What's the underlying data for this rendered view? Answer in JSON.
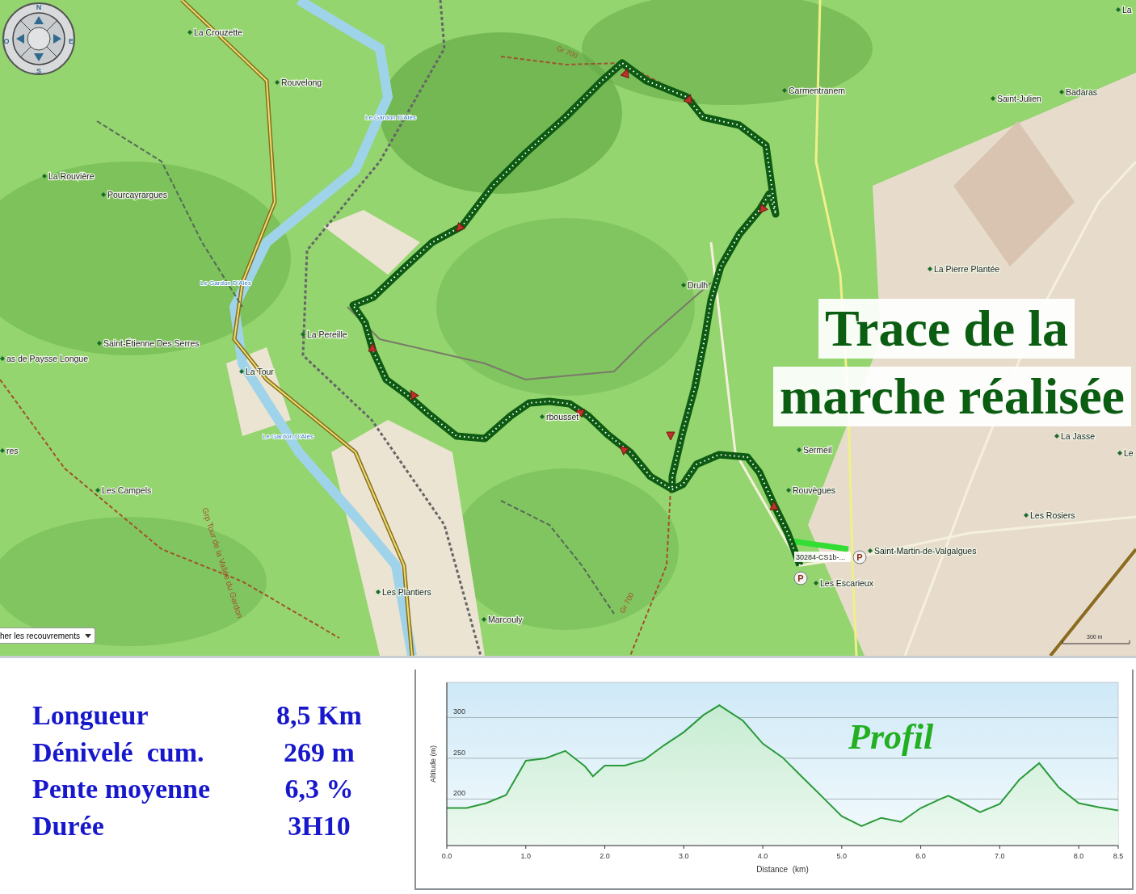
{
  "compass": {
    "labels": [
      "N",
      "E",
      "S",
      "O"
    ]
  },
  "map": {
    "places": [
      "La Crouzette",
      "Rouvelong",
      "Carmentranem",
      "Saint-Julien",
      "Badaras",
      "La",
      "La Rouvière",
      "Pourcayrargues",
      "La Pierre Plantée",
      "Drulh",
      "La Pereille",
      "Saint-Étienne Des Serres",
      "as de Paysse Longue",
      "La Tour",
      "rbousset",
      "La Jasse",
      "res",
      "Sermeil",
      "Le",
      "Les Campels",
      "Rouvègues",
      "Les Rosiers",
      "Saint-Martin-de-Valgalgues",
      "Les Escarieux",
      "Les Plantiers",
      "Marcouly"
    ],
    "river_labels": [
      "Le Gardon D'Alès",
      "Le Gardon D'Alès",
      "Le Gardon D'Alès"
    ],
    "trail_labels": [
      "Gr 700",
      "Gr 700",
      "Grp Tour de la Vallée du Gardon"
    ],
    "waypoint_label": "30284-CS1b-...",
    "parking_signs": [
      "P",
      "P"
    ],
    "scale": "300 m",
    "dropdown": "her les recouvrements"
  },
  "title": [
    "Trace de la",
    "marche réalisée"
  ],
  "stats": [
    {
      "label": "Longueur",
      "value": "8,5 Km"
    },
    {
      "label": "Dénivelé  cum.",
      "value": "269 m"
    },
    {
      "label": "Pente moyenne",
      "value": "6,3 %"
    },
    {
      "label": "Durée",
      "value": "3H10"
    }
  ],
  "profile": {
    "title": "Profil",
    "chart_data": {
      "type": "area",
      "xlabel": "Distance  (km)",
      "ylabel": "Altitude (m)",
      "x": [
        0,
        0.25,
        0.5,
        0.75,
        1.0,
        1.25,
        1.5,
        1.75,
        1.85,
        2.0,
        2.25,
        2.5,
        2.75,
        3.0,
        3.25,
        3.45,
        3.75,
        4.0,
        4.25,
        4.5,
        4.75,
        5.0,
        5.25,
        5.5,
        5.75,
        6.0,
        6.25,
        6.35,
        6.5,
        6.75,
        7.0,
        7.25,
        7.5,
        7.75,
        8.0,
        8.25,
        8.5
      ],
      "grid": true,
      "series": [
        {
          "color": "#2a9a3a",
          "values": [
            189,
            189,
            195,
            205,
            247,
            250,
            259,
            240,
            228,
            241,
            241,
            248,
            266,
            282,
            303,
            315,
            296,
            268,
            251,
            227,
            203,
            179,
            167,
            177,
            172,
            189,
            200,
            204,
            197,
            184,
            194,
            224,
            244,
            214,
            195,
            190,
            186
          ]
        }
      ],
      "xlim": [
        0,
        8.5
      ],
      "ylim": [
        143,
        343
      ],
      "xticks": [
        {
          "value": 0,
          "label": "0.0"
        },
        {
          "value": 1,
          "label": "1.0"
        },
        {
          "value": 2,
          "label": "2.0"
        },
        {
          "value": 3,
          "label": "3.0"
        },
        {
          "value": 4,
          "label": "4.0"
        },
        {
          "value": 5,
          "label": "5.0"
        },
        {
          "value": 6,
          "label": "6.0"
        },
        {
          "value": 7,
          "label": "7.0"
        },
        {
          "value": 8,
          "label": "8.0"
        },
        {
          "value": 8.5,
          "label": "8.5"
        }
      ],
      "yticks": [
        200,
        250,
        300
      ]
    }
  }
}
